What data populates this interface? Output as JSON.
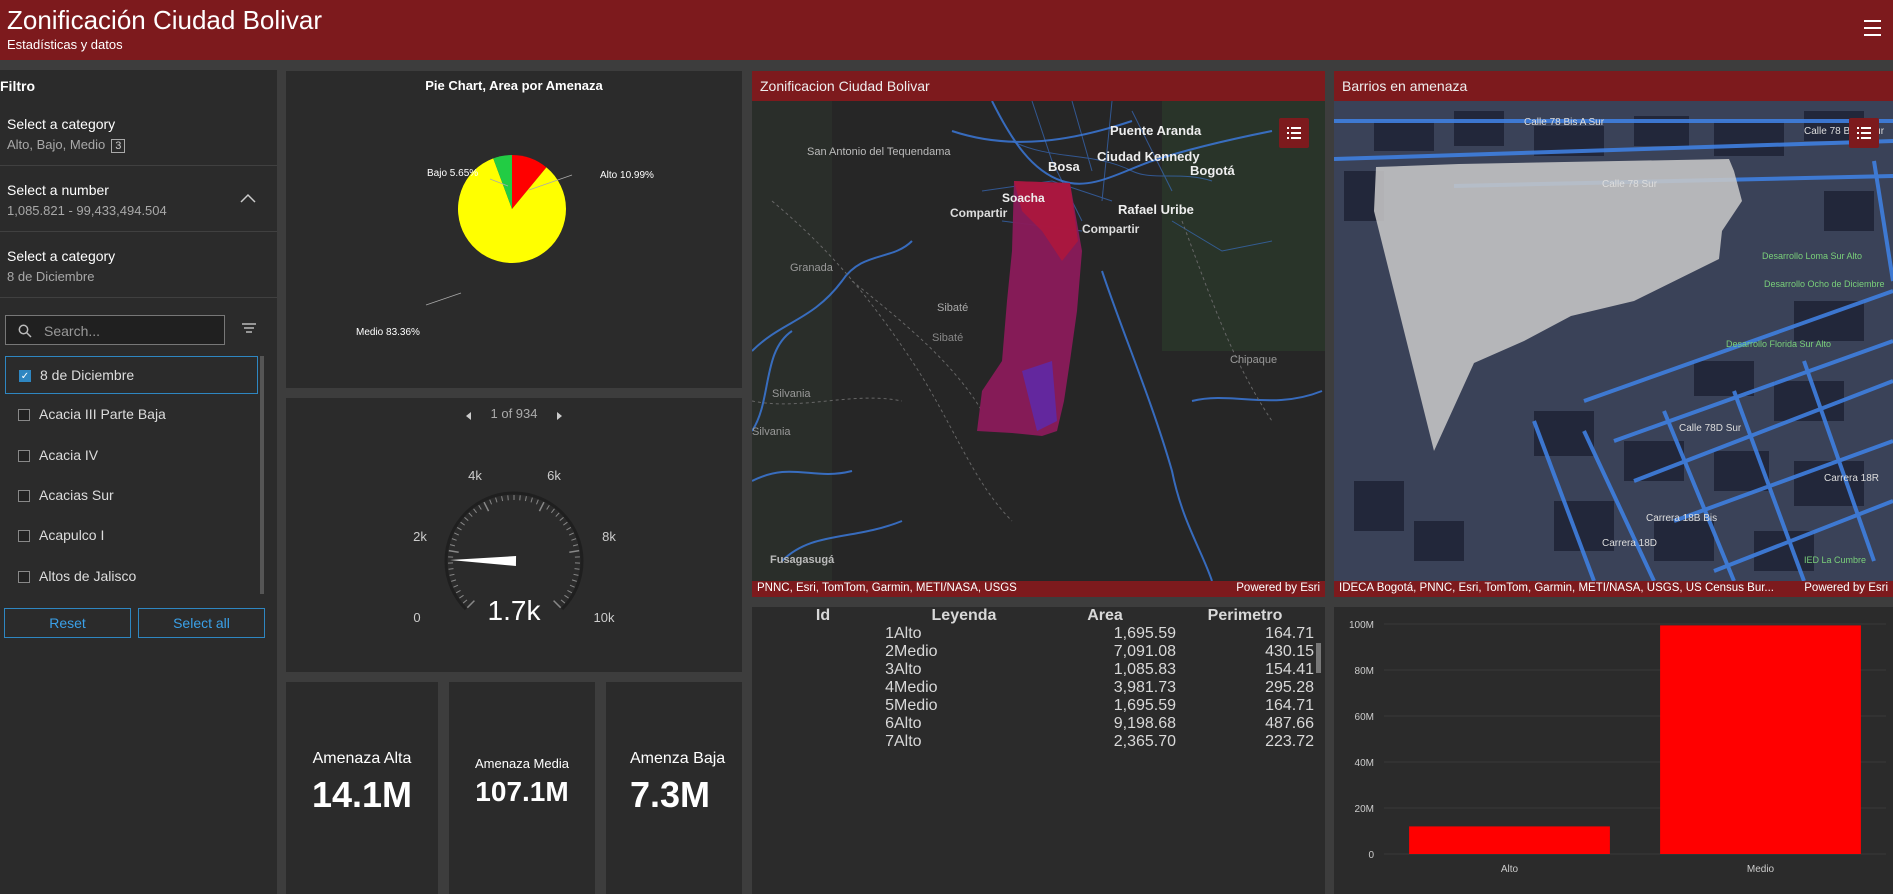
{
  "header": {
    "title": "Zonificación Ciudad Bolivar",
    "subtitle": "Estadísticas y datos",
    "menu_icon": "hamburger-icon"
  },
  "filter": {
    "title": "Filtro",
    "category1": {
      "label": "Select a category",
      "value": "Alto, Bajo, Medio",
      "count": "3"
    },
    "number": {
      "label": "Select a number",
      "value": "1,085.821 - 99,433,494.504"
    },
    "category2": {
      "label": "Select a category",
      "value": "8 de Diciembre"
    },
    "search_placeholder": "Search...",
    "items": [
      "8 de Diciembre",
      "Acacia III Parte Baja",
      "Acacia IV",
      "Acacias Sur",
      "Acapulco I",
      "Altos de Jalisco"
    ],
    "reset": "Reset",
    "select_all": "Select all"
  },
  "pie": {
    "title": "Pie Chart, Area por Amenaza",
    "labels": {
      "bajo": "Bajo 5.65%",
      "alto": "Alto 10.99%",
      "medio": "Medio 83.36%"
    }
  },
  "gauge": {
    "pager": "1 of 934",
    "value_label": "1.7k",
    "value": 1700,
    "ticks": [
      "0",
      "2k",
      "4k",
      "6k",
      "8k",
      "10k"
    ]
  },
  "indicators": [
    {
      "label": "Amenaza Alta",
      "value": "14.1M"
    },
    {
      "label": "Amenaza Media",
      "value": "107.1M"
    },
    {
      "label": "Amenza Baja",
      "value": "7.3M"
    }
  ],
  "map1": {
    "title": "Zonificacion Ciudad Bolivar",
    "attribution": "PNNC, Esri, TomTom, Garmin, METI/NASA, USGS",
    "powered": "Powered by Esri",
    "places": {
      "san_antonio": "San Antonio del Tequendama",
      "puente_aranda": "Puente Aranda",
      "ciudad_kennedy": "Ciudad Kennedy",
      "bosa": "Bosa",
      "bogota": "Bogotá",
      "soacha": "Soacha",
      "rafael_uribe": "Rafael Uribe",
      "compartir1": "Compartir",
      "compartir2": "Compartir",
      "granada": "Granada",
      "sibate1": "Sibaté",
      "sibate2": "Sibaté",
      "chipaque": "Chipaque",
      "silvania1": "Silvania",
      "silvania2": "Silvania",
      "fusagasuga": "Fusagasugá"
    }
  },
  "map2": {
    "title": "Barrios en amenaza",
    "attribution": "IDECA Bogotá, PNNC, Esri, TomTom, Garmin, METI/NASA, USGS, US Census Bur...",
    "powered": "Powered by Esri",
    "places": {
      "calle78bis": "Calle 78 Bis A Sur",
      "calle78bisa2": "Calle 78 Bis A Sur",
      "calle78sur": "Calle 78 Sur",
      "desarrollo1": "Desarrollo Loma Sur Alto",
      "desarrollo2": "Desarrollo Ocho de Diciembre",
      "desarrollo3": "Desarrollo Florida Sur Alto",
      "calle78d": "Calle 78D Sur",
      "carrera18r": "Carrera 18R",
      "carrera18b": "Carrera 18B Bis",
      "carrera18d": "Carrera 18D",
      "ied": "IED La Cumbre"
    }
  },
  "table": {
    "headers": [
      "Id",
      "Leyenda",
      "Area",
      "Perimetro"
    ],
    "rows": [
      [
        "1",
        "Alto",
        "1,695.59",
        "164.71"
      ],
      [
        "2",
        "Medio",
        "7,091.08",
        "430.15"
      ],
      [
        "3",
        "Alto",
        "1,085.83",
        "154.41"
      ],
      [
        "4",
        "Medio",
        "3,981.73",
        "295.28"
      ],
      [
        "5",
        "Medio",
        "1,695.59",
        "164.71"
      ],
      [
        "6",
        "Alto",
        "9,198.68",
        "487.66"
      ],
      [
        "7",
        "Alto",
        "2,365.70",
        "223.72"
      ]
    ]
  },
  "chart_data": [
    {
      "type": "pie",
      "title": "Pie Chart, Area por Amenaza",
      "categories": [
        "Alto",
        "Bajo",
        "Medio"
      ],
      "values": [
        10.99,
        5.65,
        83.36
      ],
      "colors": [
        "#ff0000",
        "#22cc44",
        "#ffff00"
      ]
    },
    {
      "type": "bar",
      "categories": [
        "Alto",
        "Medio"
      ],
      "values": [
        12000000,
        99400000
      ],
      "ylim": [
        0,
        100000000
      ],
      "yticks": [
        "0",
        "20M",
        "40M",
        "60M",
        "80M",
        "100M"
      ],
      "color": "#ff0000"
    }
  ]
}
